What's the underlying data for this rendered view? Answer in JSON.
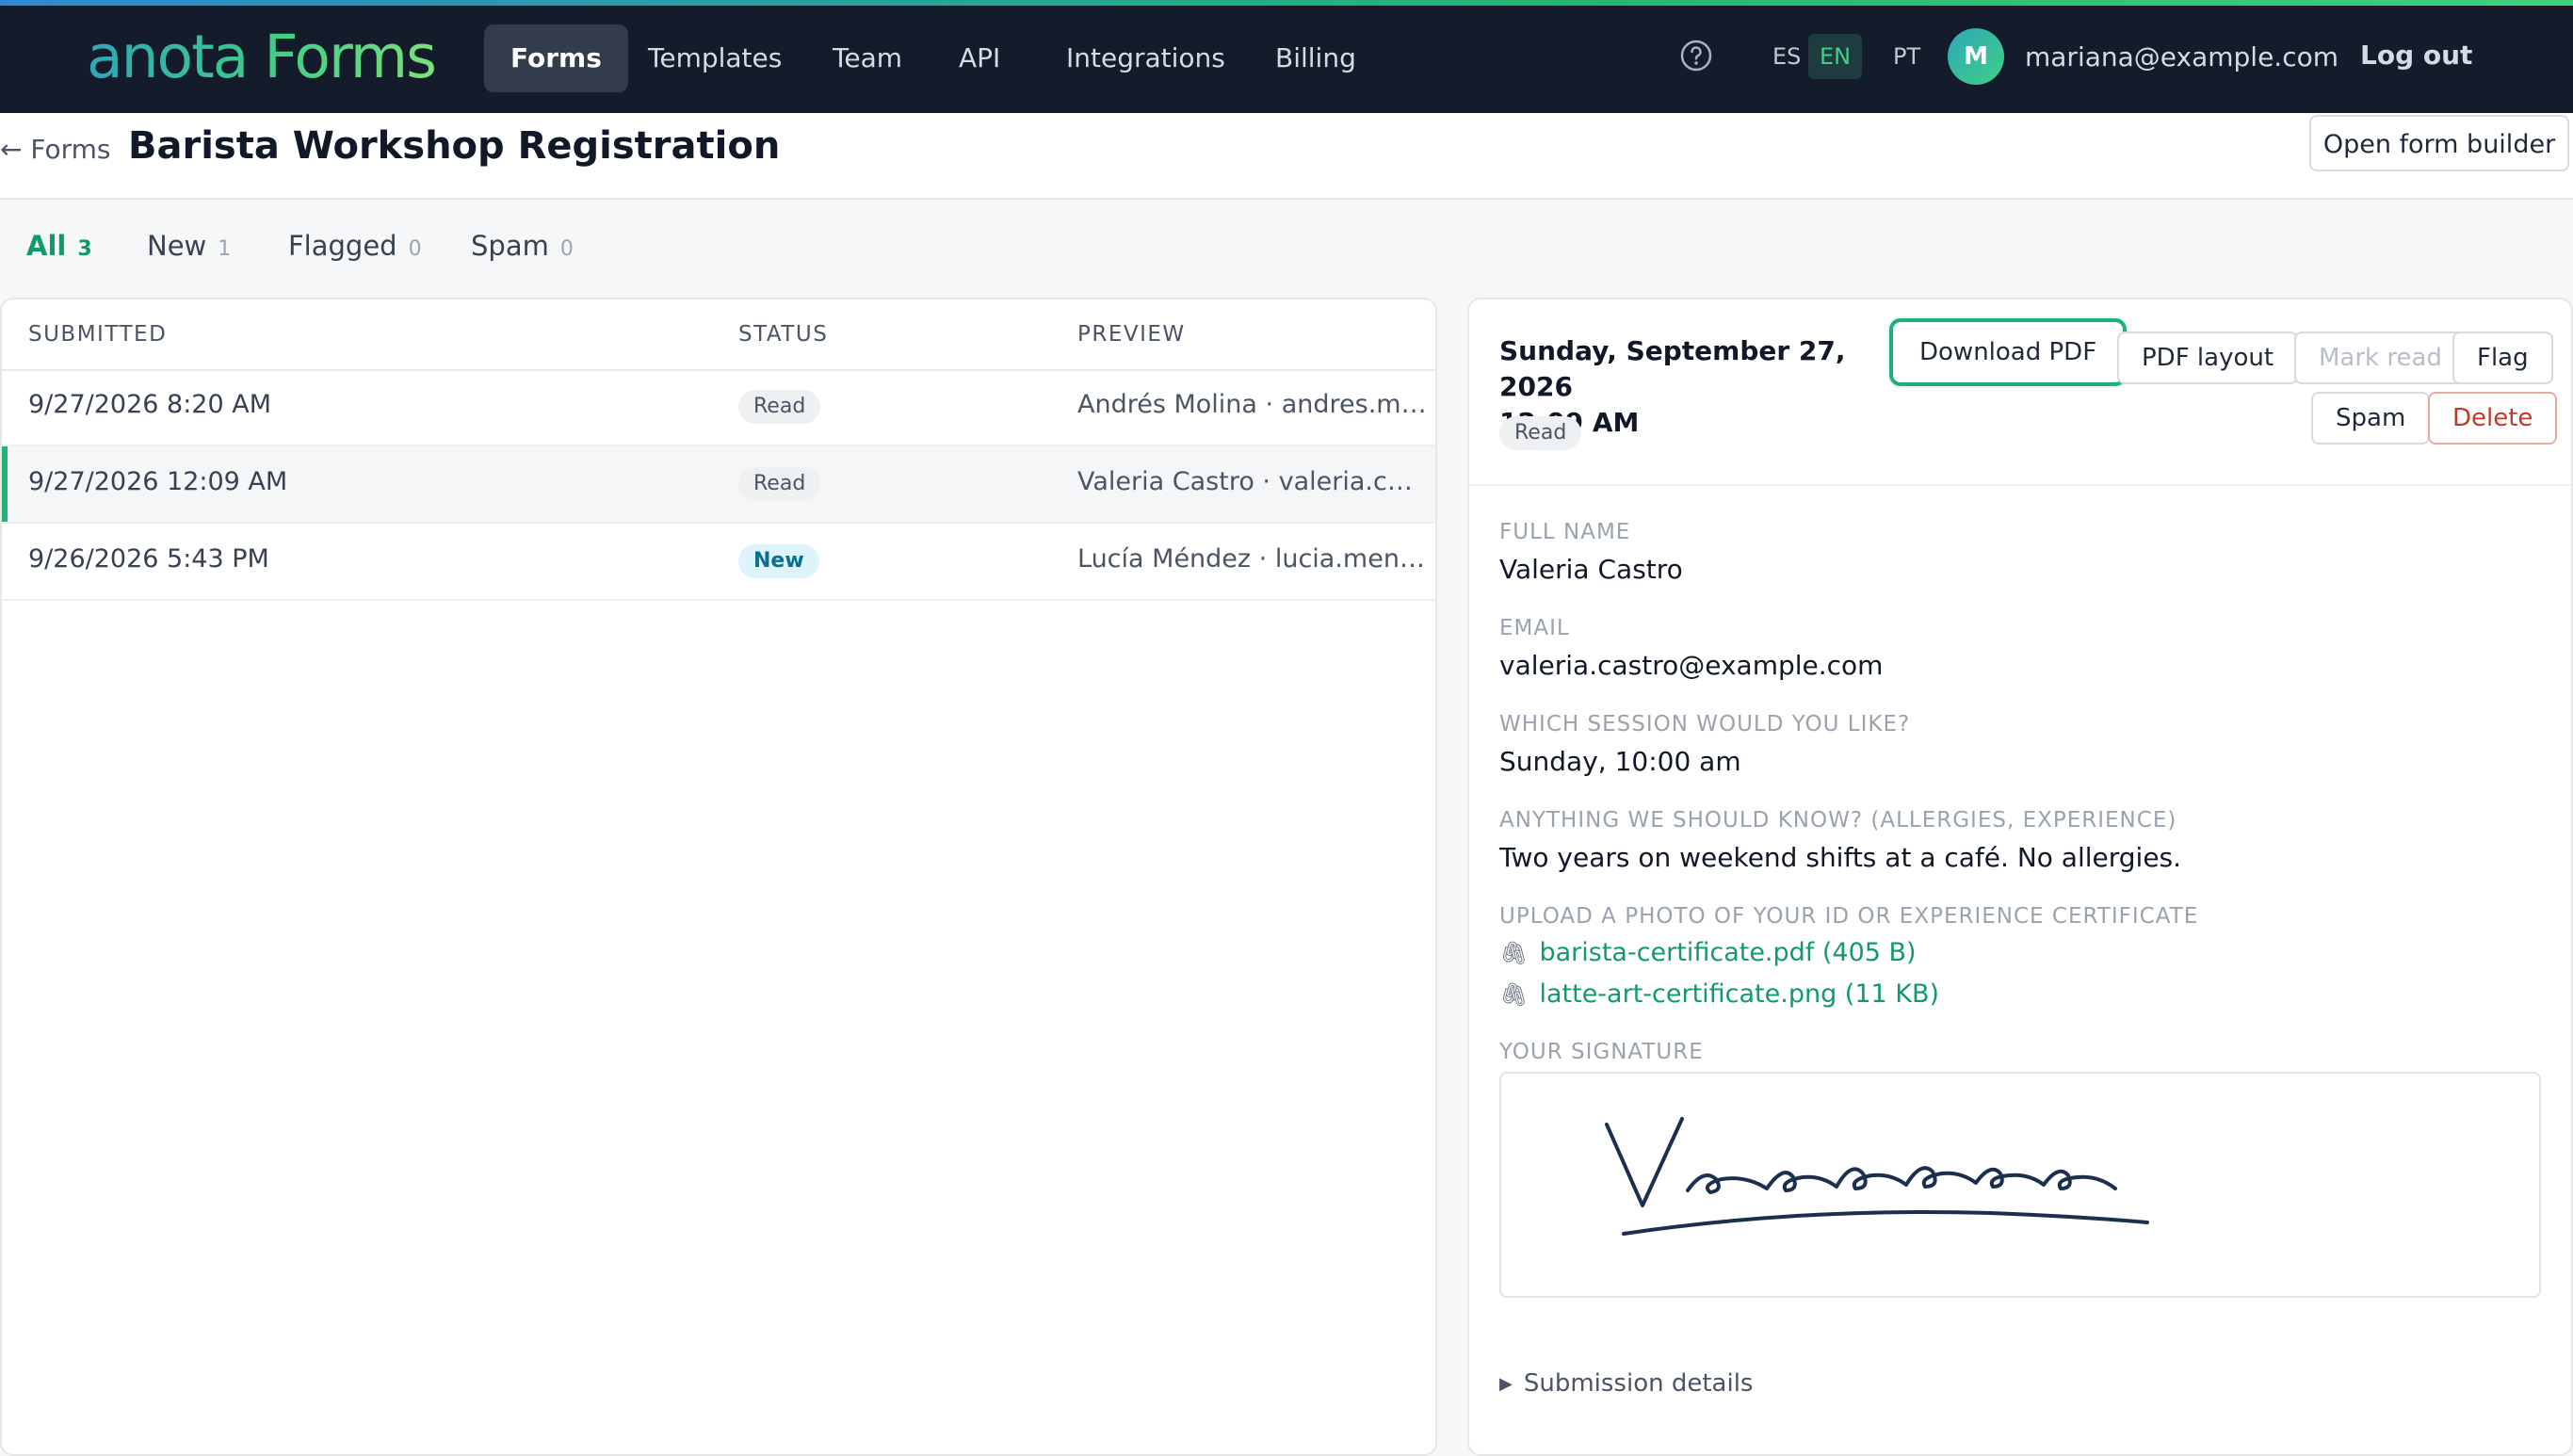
{
  "app": {
    "logo_text": "anota Forms"
  },
  "nav": {
    "items": [
      {
        "label": "Forms",
        "active": true
      },
      {
        "label": "Templates"
      },
      {
        "label": "Team"
      },
      {
        "label": "API"
      },
      {
        "label": "Integrations"
      },
      {
        "label": "Billing"
      }
    ]
  },
  "header": {
    "languages": [
      "ES",
      "EN",
      "PT"
    ],
    "active_language": "EN",
    "avatar_initial": "M",
    "user_email": "mariana@example.com",
    "logout_label": "Log out"
  },
  "page": {
    "back_label": "← Forms",
    "title": "Barista Workshop Registration",
    "open_builder_label": "Open form builder"
  },
  "filters": [
    {
      "label": "All",
      "count": "3",
      "active": true
    },
    {
      "label": "New",
      "count": "1"
    },
    {
      "label": "Flagged",
      "count": "0"
    },
    {
      "label": "Spam",
      "count": "0"
    }
  ],
  "list": {
    "columns": [
      "SUBMITTED",
      "STATUS",
      "PREVIEW"
    ],
    "rows": [
      {
        "submitted": "9/27/2026 8:20 AM",
        "status": "Read",
        "preview": "Andrés Molina · andres.molina@example.com"
      },
      {
        "submitted": "9/27/2026 12:09 AM",
        "status": "Read",
        "preview": "Valeria Castro · valeria.castro@example.com",
        "selected": true
      },
      {
        "submitted": "9/26/2026 5:43 PM",
        "status": "New",
        "preview": "Lucía Méndez · lucia.mendez@example.com"
      }
    ]
  },
  "detail": {
    "date_line1": "Sunday, September 27, 2026",
    "date_line2": "12:09 AM",
    "status": "Read",
    "buttons": {
      "download_pdf": "Download PDF",
      "pdf_layout": "PDF layout",
      "mark_read": "Mark read",
      "flag": "Flag",
      "spam": "Spam",
      "delete": "Delete"
    },
    "fields": [
      {
        "label": "FULL NAME",
        "value": "Valeria Castro"
      },
      {
        "label": "EMAIL",
        "value": "valeria.castro@example.com"
      },
      {
        "label": "WHICH SESSION WOULD YOU LIKE?",
        "value": "Sunday, 10:00 am"
      },
      {
        "label": "ANYTHING WE SHOULD KNOW? (ALLERGIES, EXPERIENCE)",
        "value": "Two years on weekend shifts at a café. No allergies."
      }
    ],
    "upload_label": "UPLOAD A PHOTO OF YOUR ID OR EXPERIENCE CERTIFICATE",
    "files": [
      {
        "name": "barista-certificate.pdf (405 B)"
      },
      {
        "name": "latte-art-certificate.png (11 KB)"
      }
    ],
    "signature_label": "YOUR SIGNATURE",
    "submission_details_label": "Submission details"
  },
  "colors": {
    "accent": "#22b573",
    "topbar": "#141c2b",
    "danger": "#c0392b"
  }
}
